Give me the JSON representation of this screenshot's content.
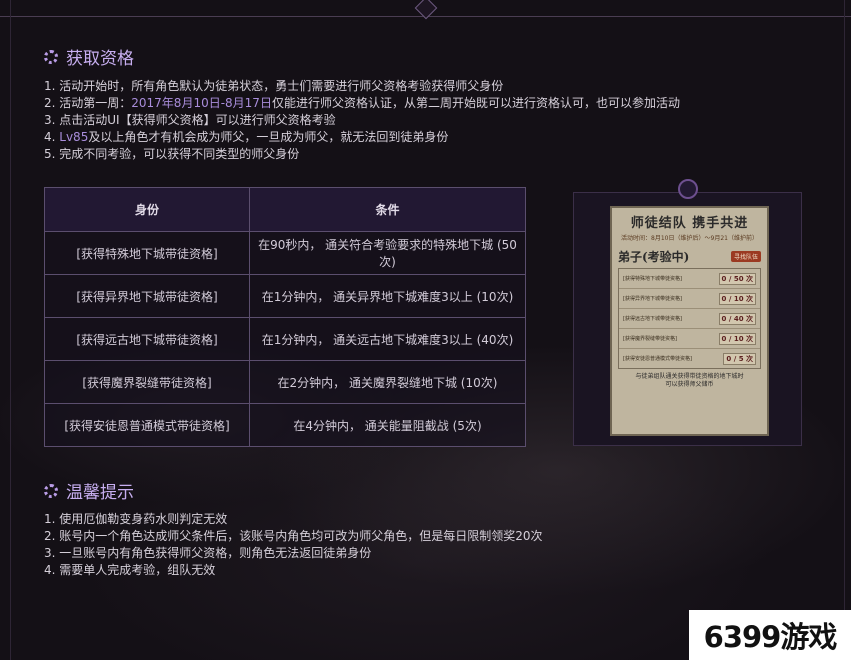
{
  "section1": {
    "title": "获取资格",
    "items": [
      {
        "prefix": "1. 活动开始时，所有角色默认为徒弟状态，勇士们需要进行师父资格考验获得师父身份",
        "hl": "",
        "suffix": ""
      },
      {
        "prefix": "2. 活动第一周：",
        "hl": "2017年8月10日-8月17日",
        "suffix": "仅能进行师父资格认证，从第二周开始既可以进行资格认可，也可以参加活动"
      },
      {
        "prefix": "3. 点击活动UI【获得师父资格】可以进行师父资格考验",
        "hl": "",
        "suffix": ""
      },
      {
        "prefix": "4. ",
        "hl": "Lv85",
        "suffix": "及以上角色才有机会成为师父，一旦成为师父，就无法回到徒弟身份"
      },
      {
        "prefix": "5. 完成不同考验，可以获得不同类型的师父身份",
        "hl": "",
        "suffix": ""
      }
    ]
  },
  "table": {
    "headers": [
      "身份",
      "条件"
    ],
    "rows": [
      [
        "[获得特殊地下城带徒资格]",
        "在90秒内， 通关符合考验要求的特殊地下城 (50次)"
      ],
      [
        "[获得异界地下城带徒资格]",
        "在1分钟内， 通关异界地下城难度3以上 (10次)"
      ],
      [
        "[获得远古地下城带徒资格]",
        "在1分钟内， 通关远古地下城难度3以上 (40次)"
      ],
      [
        "[获得魔界裂缝带徒资格]",
        "在2分钟内， 通关魔界裂缝地下城 (10次)"
      ],
      [
        "[获得安徒恩普通模式带徒资格]",
        "在4分钟内， 通关能量阻截战 (5次)"
      ]
    ]
  },
  "poster": {
    "title": "师徒结队 携手共进",
    "date": "活动时间：8月10日（维护后）～9月21（维护前）",
    "disciple": "弟子(考验中)",
    "find_team": "寻找队伍",
    "rows": [
      {
        "text": "[获得特殊地下城带徒资格]",
        "count": "0 / 50 次"
      },
      {
        "text": "[获得异界地下城带徒资格]",
        "count": "0 / 10 次"
      },
      {
        "text": "[获得远古地下城带徒资格]",
        "count": "0 / 40 次"
      },
      {
        "text": "[获得魔界裂缝带徒资格]",
        "count": "0 / 10 次"
      },
      {
        "text": "[获得安徒恩普通模式带徒资格]",
        "count": "0 / 5 次"
      }
    ],
    "footer": "与徒弟组队通关获得带徒资格的地下城时\n可以获得师父储币"
  },
  "section2": {
    "title": "温馨提示",
    "items": [
      "1. 使用厄伽勒变身药水则判定无效",
      "2. 账号内一个角色达成师父条件后，该账号内角色均可改为师父角色，但是每日限制领奖20次",
      "3. 一旦账号内有角色获得师父资格，则角色无法返回徒弟身份",
      "4. 需要单人完成考验，组队无效"
    ]
  },
  "watermark": "6399游戏",
  "colors": {
    "accent": "#a98ddb",
    "title": "#c7aef0",
    "table_border": "#5b4e6e"
  }
}
